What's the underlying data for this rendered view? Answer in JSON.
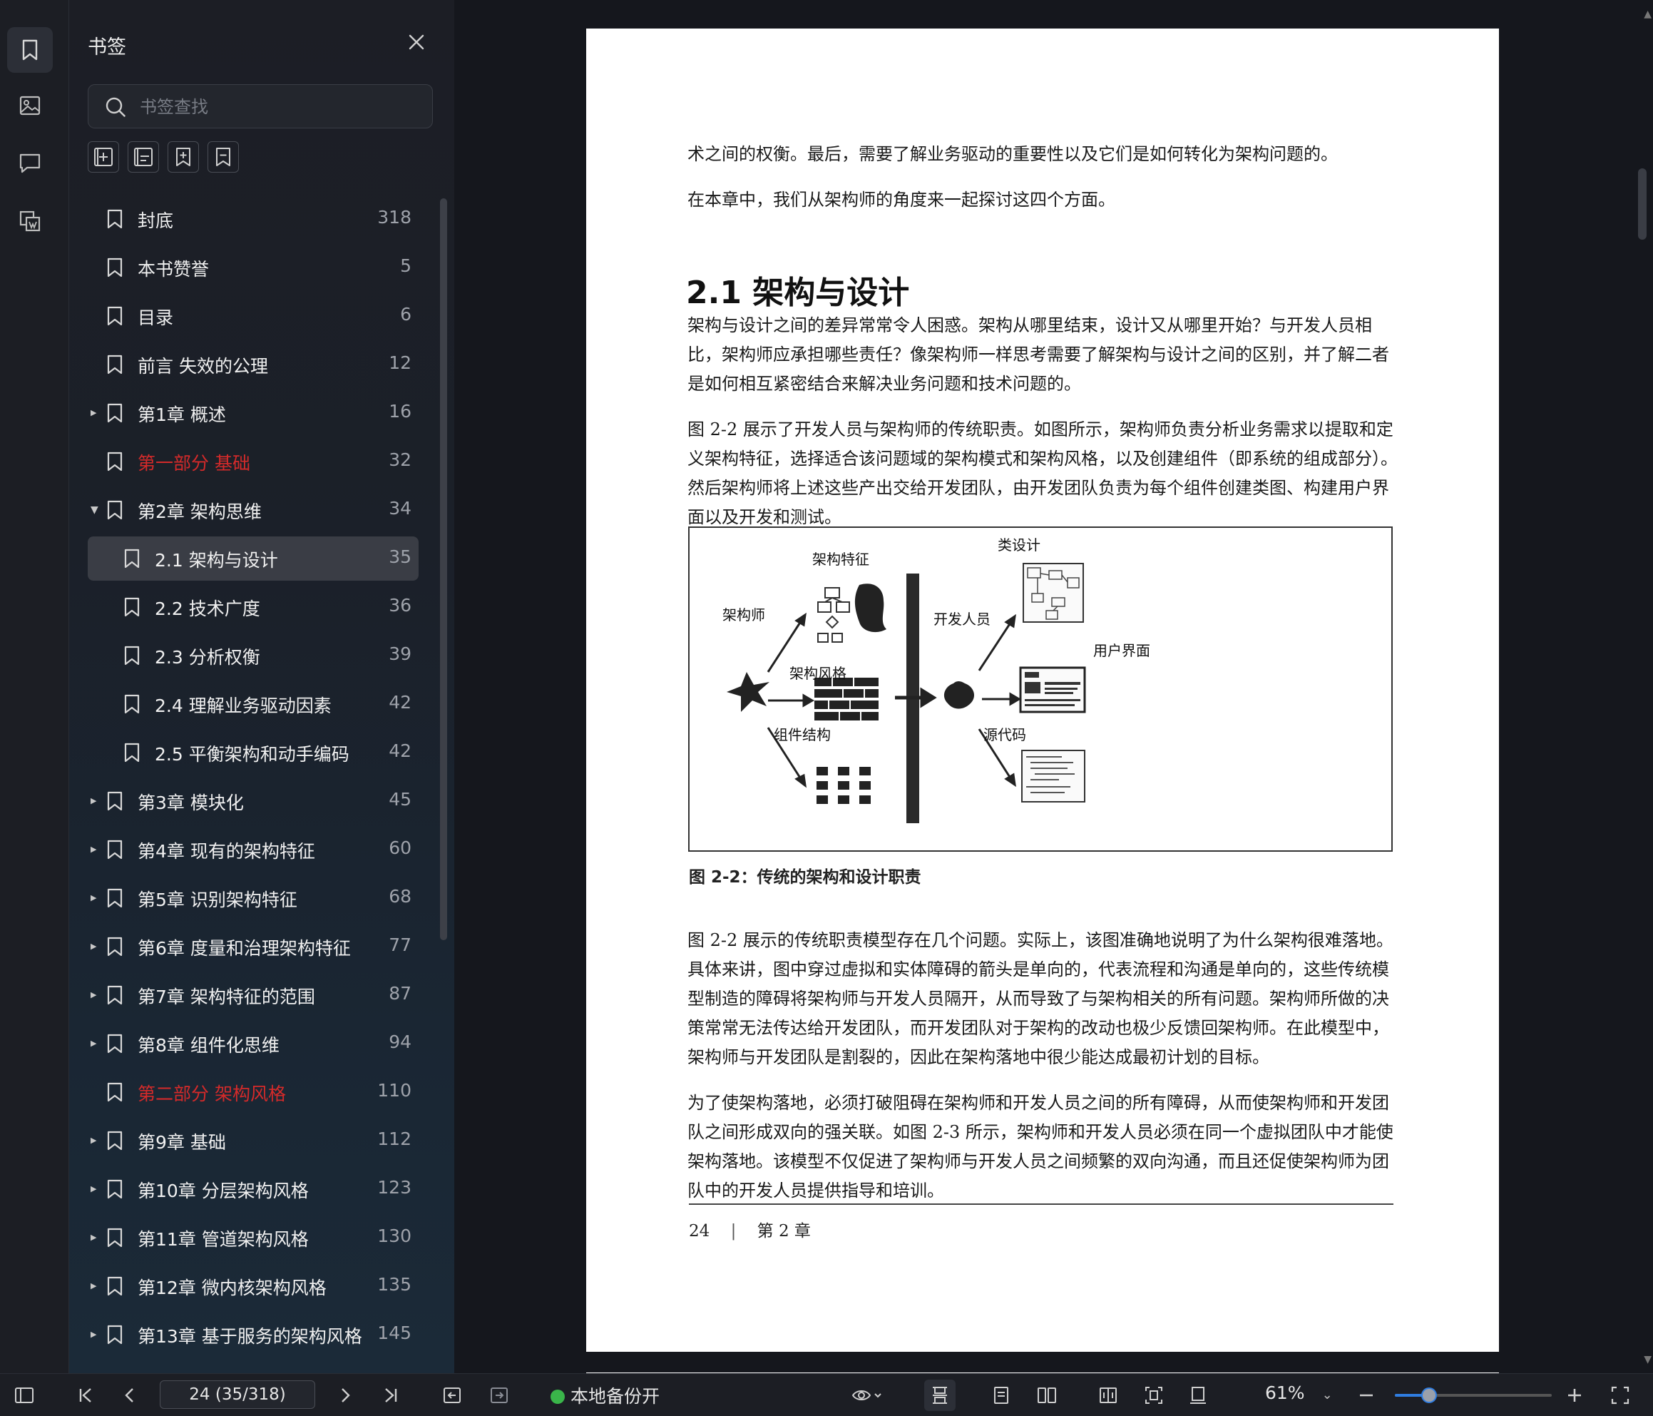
{
  "panel": {
    "title": "书签",
    "search_placeholder": "书签查找"
  },
  "bookmarks": [
    {
      "label": "封底",
      "page": "318",
      "level": 0,
      "caret": "",
      "red": false,
      "selected": false
    },
    {
      "label": "本书赞誉",
      "page": "5",
      "level": 0,
      "caret": "",
      "red": false,
      "selected": false
    },
    {
      "label": "目录",
      "page": "6",
      "level": 0,
      "caret": "",
      "red": false,
      "selected": false
    },
    {
      "label": "前言 失效的公理",
      "page": "12",
      "level": 0,
      "caret": "",
      "red": false,
      "selected": false
    },
    {
      "label": "第1章 概述",
      "page": "16",
      "level": 0,
      "caret": "collapsed",
      "red": false,
      "selected": false
    },
    {
      "label": "第一部分 基础",
      "page": "32",
      "level": 0,
      "caret": "",
      "red": true,
      "selected": false
    },
    {
      "label": "第2章 架构思维",
      "page": "34",
      "level": 0,
      "caret": "expanded",
      "red": false,
      "selected": false
    },
    {
      "label": "2.1 架构与设计",
      "page": "35",
      "level": 1,
      "caret": "",
      "red": false,
      "selected": true
    },
    {
      "label": "2.2 技术广度",
      "page": "36",
      "level": 1,
      "caret": "",
      "red": false,
      "selected": false
    },
    {
      "label": "2.3 分析权衡",
      "page": "39",
      "level": 1,
      "caret": "",
      "red": false,
      "selected": false
    },
    {
      "label": "2.4 理解业务驱动因素",
      "page": "42",
      "level": 1,
      "caret": "",
      "red": false,
      "selected": false
    },
    {
      "label": "2.5 平衡架构和动手编码",
      "page": "42",
      "level": 1,
      "caret": "",
      "red": false,
      "selected": false
    },
    {
      "label": "第3章 模块化",
      "page": "45",
      "level": 0,
      "caret": "collapsed",
      "red": false,
      "selected": false
    },
    {
      "label": "第4章 现有的架构特征",
      "page": "60",
      "level": 0,
      "caret": "collapsed",
      "red": false,
      "selected": false
    },
    {
      "label": "第5章 识别架构特征",
      "page": "68",
      "level": 0,
      "caret": "collapsed",
      "red": false,
      "selected": false
    },
    {
      "label": "第6章 度量和治理架构特征",
      "page": "77",
      "level": 0,
      "caret": "collapsed",
      "red": false,
      "selected": false
    },
    {
      "label": "第7章 架构特征的范围",
      "page": "87",
      "level": 0,
      "caret": "collapsed",
      "red": false,
      "selected": false
    },
    {
      "label": "第8章 组件化思维",
      "page": "94",
      "level": 0,
      "caret": "collapsed",
      "red": false,
      "selected": false
    },
    {
      "label": "第二部分 架构风格",
      "page": "110",
      "level": 0,
      "caret": "",
      "red": true,
      "selected": false
    },
    {
      "label": "第9章 基础",
      "page": "112",
      "level": 0,
      "caret": "collapsed",
      "red": false,
      "selected": false
    },
    {
      "label": "第10章 分层架构风格",
      "page": "123",
      "level": 0,
      "caret": "collapsed",
      "red": false,
      "selected": false
    },
    {
      "label": "第11章 管道架构风格",
      "page": "130",
      "level": 0,
      "caret": "collapsed",
      "red": false,
      "selected": false
    },
    {
      "label": "第12章 微内核架构风格",
      "page": "135",
      "level": 0,
      "caret": "collapsed",
      "red": false,
      "selected": false
    },
    {
      "label": "第13章 基于服务的架构风格",
      "page": "145",
      "level": 0,
      "caret": "collapsed",
      "red": false,
      "selected": false
    }
  ],
  "document": {
    "p1": "术之间的权衡。最后，需要了解业务驱动的重要性以及它们是如何转化为架构问题的。",
    "p2": "在本章中，我们从架构师的角度来一起探讨这四个方面。",
    "heading": "2.1 架构与设计",
    "p3": "架构与设计之间的差异常常令人困惑。架构从哪里结束，设计又从哪里开始？与开发人员相比，架构师应承担哪些责任？像架构师一样思考需要了解架构与设计之间的区别，并了解二者是如何相互紧密结合来解决业务问题和技术问题的。",
    "p4": "图 2-2 展示了开发人员与架构师的传统职责。如图所示，架构师负责分析业务需求以提取和定义架构特征，选择适合该问题域的架构模式和架构风格，以及创建组件（即系统的组成部分）。然后架构师将上述这些产出交给开发团队，由开发团队负责为每个组件创建类图、构建用户界面以及开发和测试。",
    "figure": {
      "architect": "架构师",
      "characteristics": "架构特征",
      "styles": "架构风格",
      "components": "组件结构",
      "developer": "开发人员",
      "class_design": "类设计",
      "ui": "用户界面",
      "source_code": "源代码"
    },
    "caption": "图 2-2：传统的架构和设计职责",
    "p5": "图 2-2 展示的传统职责模型存在几个问题。实际上，该图准确地说明了为什么架构很难落地。具体来讲，图中穿过虚拟和实体障碍的箭头是单向的，代表流程和沟通是单向的，这些传统模型制造的障碍将架构师与开发人员隔开，从而导致了与架构相关的所有问题。架构师所做的决策常常无法传达给开发团队，而开发团队对于架构的改动也极少反馈回架构师。在此模型中，架构师与开发团队是割裂的，因此在架构落地中很少能达成最初计划的目标。",
    "p6": "为了使架构落地，必须打破阻碍在架构师和开发人员之间的所有障碍，从而使架构师和开发团队之间形成双向的强关联。如图 2-3 所示，架构师和开发人员必须在同一个虚拟团队中才能使架构落地。该模型不仅促进了架构师与开发人员之间频繁的双向沟通，而且还促使架构师为团队中的开发人员提供指导和培训。",
    "footer_page": "24",
    "footer_chapter": "第 2 章"
  },
  "toolbar": {
    "page_indicator": "24 (35/318)",
    "backup_status": "本地备份开",
    "zoom": "61%",
    "zoom_fraction": 0.22
  },
  "icons": [
    "bookmark-icon",
    "image-icon",
    "comment-icon",
    "ocr-icon",
    "close-icon",
    "search-icon",
    "add-bookmark-icon",
    "add-child-bookmark-icon",
    "expand-bookmark-icon",
    "collapse-bookmark-icon",
    "sidebar-toggle-icon",
    "first-page-icon",
    "prev-page-icon",
    "next-page-icon",
    "last-page-icon",
    "back-icon",
    "forward-icon",
    "eye-icon",
    "fit-width-icon",
    "single-page-icon",
    "double-page-icon",
    "book-mode-icon",
    "fit-page-icon",
    "rotate-icon",
    "zoom-out-icon",
    "zoom-in-icon",
    "fullscreen-icon"
  ],
  "colors": {
    "red_section": "#d42a2a",
    "accent": "#2f7de1",
    "backup_ok": "#3ab54a"
  }
}
